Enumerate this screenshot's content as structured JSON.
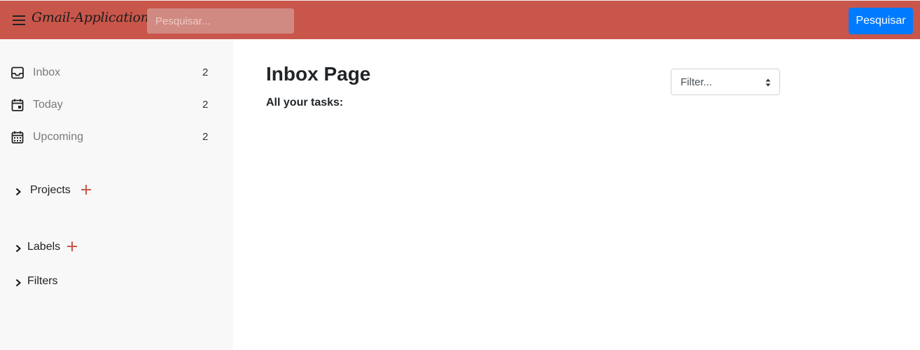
{
  "header": {
    "brand": "Gmail-Application",
    "search_placeholder": "Pesquisar...",
    "search_button": "Pesquisar"
  },
  "sidebar": {
    "items": [
      {
        "label": "Inbox",
        "count": "2",
        "icon": "inbox-icon"
      },
      {
        "label": "Today",
        "count": "2",
        "icon": "calendar-today-icon"
      },
      {
        "label": "Upcoming",
        "count": "2",
        "icon": "calendar-upcoming-icon"
      }
    ],
    "sections": [
      {
        "label": "Projects",
        "has_add": true
      },
      {
        "label": "Labels",
        "has_add": true
      },
      {
        "label": "Filters",
        "has_add": false
      }
    ]
  },
  "main": {
    "title": "Inbox Page",
    "subtitle": "All your tasks:",
    "filter_placeholder": "Filter..."
  },
  "colors": {
    "header_bg": "#c9564a",
    "accent_plus": "#c9564a",
    "button_blue": "#007bff",
    "sidebar_bg": "#f8f8f8"
  }
}
